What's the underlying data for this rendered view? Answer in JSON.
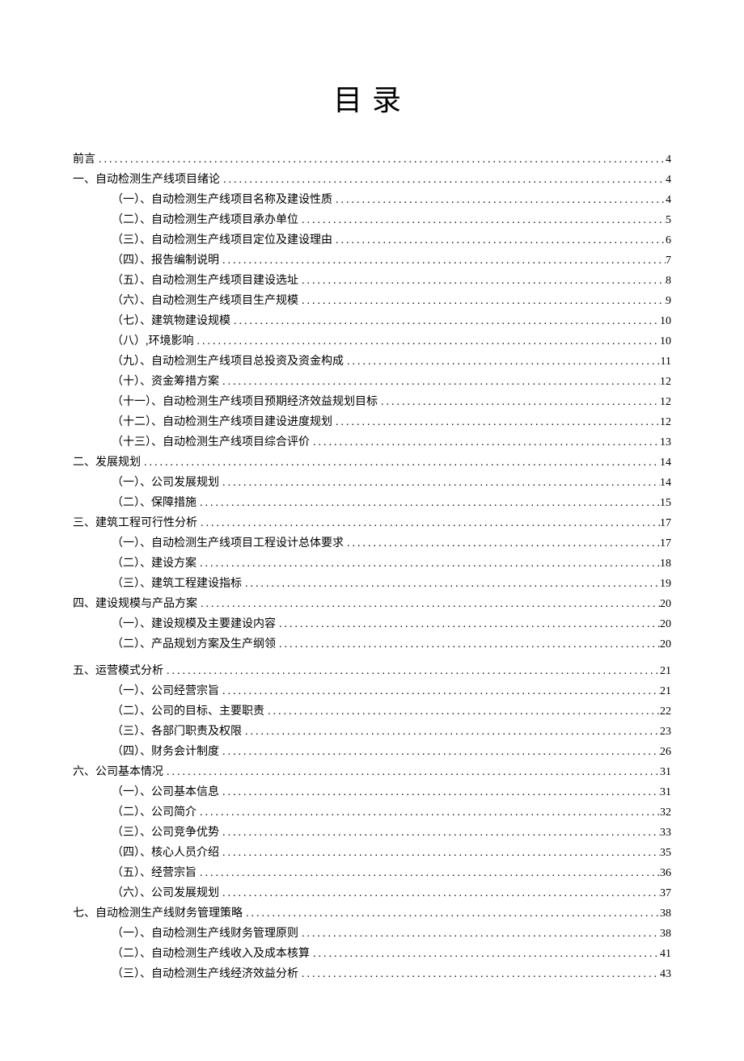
{
  "title": "目录",
  "toc": [
    {
      "level": 0,
      "label": "前言",
      "page": "4"
    },
    {
      "level": 0,
      "label": "一、自动检测生产线项目绪论",
      "page": "4"
    },
    {
      "level": 1,
      "label": "（一）、自动检测生产线项目名称及建设性质",
      "page": "4"
    },
    {
      "level": 1,
      "label": "（二）、自动检测生产线项目承办单位",
      "page": "5"
    },
    {
      "level": 1,
      "label": "（三）、自动检测生产线项目定位及建设理由",
      "page": "6"
    },
    {
      "level": 1,
      "label": "（四）、报告编制说明",
      "page": "7"
    },
    {
      "level": 1,
      "label": "（五）、自动检测生产线项目建设选址",
      "page": "8"
    },
    {
      "level": 1,
      "label": "（六）、自动检测生产线项目生产规模",
      "page": "9"
    },
    {
      "level": 1,
      "label": "（七）、建筑物建设规模",
      "page": "10"
    },
    {
      "level": 1,
      "label": "（八）,环境影响",
      "page": "10"
    },
    {
      "level": 1,
      "label": "（九）、自动检测生产线项目总投资及资金构成",
      "page": "11"
    },
    {
      "level": 1,
      "label": "（十）、资金筹措方案",
      "page": "12"
    },
    {
      "level": 1,
      "label": "（十一）、自动检测生产线项目预期经济效益规划目标",
      "page": "12"
    },
    {
      "level": 1,
      "label": "（十二）、自动检测生产线项目建设进度规划",
      "page": "12"
    },
    {
      "level": 1,
      "label": "（十三）、自动检测生产线项目综合评价",
      "page": "13"
    },
    {
      "level": 0,
      "label": "二、发展规划",
      "page": "14"
    },
    {
      "level": 1,
      "label": "（一）、公司发展规划",
      "page": "14"
    },
    {
      "level": 1,
      "label": "（二）、保障措施",
      "page": "15"
    },
    {
      "level": 0,
      "label": "三、建筑工程可行性分析",
      "page": "17"
    },
    {
      "level": 1,
      "label": "（一）、自动检测生产线项目工程设计总体要求",
      "page": "17"
    },
    {
      "level": 1,
      "label": "（二）、建设方案",
      "page": "18"
    },
    {
      "level": 1,
      "label": "（三）、建筑工程建设指标",
      "page": "19"
    },
    {
      "level": 0,
      "label": "四、建设规模与产品方案",
      "page": "20"
    },
    {
      "level": 1,
      "label": "（一）、建设规模及主要建设内容",
      "page": "20"
    },
    {
      "level": 1,
      "label": "（二）、产品规划方案及生产纲领",
      "page": "20"
    },
    {
      "level": 0,
      "label": "五、运营模式分析",
      "page": "21",
      "gapBefore": true
    },
    {
      "level": 1,
      "label": "（一）、公司经营宗旨",
      "page": "21"
    },
    {
      "level": 1,
      "label": "（二）、公司的目标、主要职责",
      "page": "22"
    },
    {
      "level": 1,
      "label": "（三）、各部门职责及权限",
      "page": "23"
    },
    {
      "level": 1,
      "label": "（四）、财务会计制度",
      "page": "26"
    },
    {
      "level": 0,
      "label": "六、公司基本情况",
      "page": "31"
    },
    {
      "level": 1,
      "label": "（一）、公司基本信息",
      "page": "31"
    },
    {
      "level": 1,
      "label": "（二）、公司简介",
      "page": "32"
    },
    {
      "level": 1,
      "label": "（三）、公司竞争优势",
      "page": "33"
    },
    {
      "level": 1,
      "label": "（四）、核心人员介绍",
      "page": "35"
    },
    {
      "level": 1,
      "label": "（五）、经营宗旨",
      "page": "36"
    },
    {
      "level": 1,
      "label": "（六）、公司发展规划",
      "page": "37"
    },
    {
      "level": 0,
      "label": "七、自动检测生产线财务管理策略",
      "page": "38"
    },
    {
      "level": 1,
      "label": "（一）、自动检测生产线财务管理原则",
      "page": "38"
    },
    {
      "level": 1,
      "label": "（二）、自动检测生产线收入及成本核算",
      "page": "41"
    },
    {
      "level": 1,
      "label": "（三）、自动检测生产线经济效益分析",
      "page": "43"
    }
  ]
}
